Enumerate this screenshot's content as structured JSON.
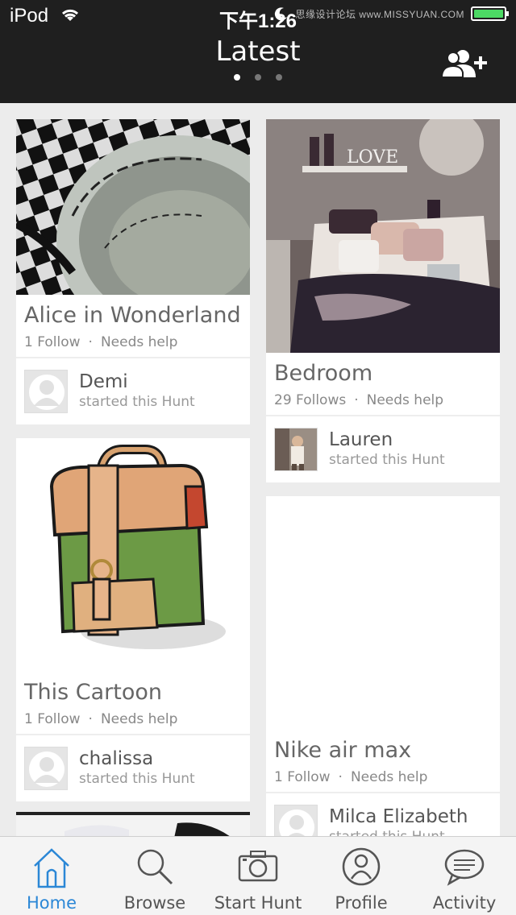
{
  "status_bar": {
    "carrier": "iPod",
    "time": "下午1:26",
    "watermark": "思缘设计论坛 www.MISSYUAN.COM",
    "battery_level": 1.0
  },
  "header": {
    "title": "Latest",
    "page_dots": {
      "count": 3,
      "active_index": 0
    },
    "add_friend_icon": "person-plus-icon"
  },
  "feed": {
    "cards": [
      {
        "title": "Alice in Wonderland",
        "follows": "1 Follow",
        "status": "Needs help",
        "user": "Demi",
        "action": "started this Hunt",
        "image": "teacup-with-quote",
        "avatar": "default-avatar"
      },
      {
        "title": "Bedroom",
        "follows": "29 Follows",
        "status": "Needs help",
        "user": "Lauren",
        "action": "started this Hunt",
        "image": "bedroom-photo",
        "image_text": "LOVE",
        "avatar": "photo-avatar"
      },
      {
        "title": "This Cartoon",
        "follows": "1 Follow",
        "status": "Needs help",
        "user": "chalissa",
        "action": "started this Hunt",
        "image": "cartoon-backpack",
        "avatar": "default-avatar"
      },
      {
        "title": "Nike air max",
        "follows": "1 Follow",
        "status": "Needs help",
        "user": "Milca Elizabeth",
        "action": "started this Hunt",
        "image": "blank",
        "avatar": "default-avatar"
      }
    ]
  },
  "tabbar": {
    "active": "Home",
    "tabs": [
      {
        "label": "Home",
        "icon": "house-icon"
      },
      {
        "label": "Browse",
        "icon": "magnifier-icon"
      },
      {
        "label": "Start Hunt",
        "icon": "camera-icon"
      },
      {
        "label": "Profile",
        "icon": "person-circle-icon"
      },
      {
        "label": "Activity",
        "icon": "speech-bubble-icon"
      }
    ]
  },
  "colors": {
    "header_bg": "#1f1f1f",
    "accent": "#2b87d6",
    "page_bg": "#ececec",
    "battery": "#4cd964"
  }
}
